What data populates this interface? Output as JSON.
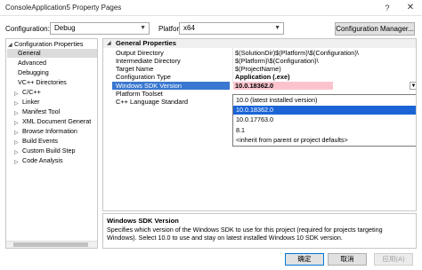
{
  "window": {
    "title": "ConsoleApplication5 Property Pages",
    "help_glyph": "?",
    "close_glyph": "✕"
  },
  "config": {
    "configuration_label": "Configuration:",
    "configuration_value": "Debug",
    "platform_label": "Platform:",
    "platform_value": "x64",
    "manager_button": "Configuration Manager..."
  },
  "tree": {
    "root": "Configuration Properties",
    "items": [
      {
        "label": "General",
        "selected": true,
        "expandable": false
      },
      {
        "label": "Advanced",
        "expandable": false
      },
      {
        "label": "Debugging",
        "expandable": false
      },
      {
        "label": "VC++ Directories",
        "expandable": false
      },
      {
        "label": "C/C++",
        "expandable": true
      },
      {
        "label": "Linker",
        "expandable": true
      },
      {
        "label": "Manifest Tool",
        "expandable": true
      },
      {
        "label": "XML Document Generat",
        "expandable": true
      },
      {
        "label": "Browse Information",
        "expandable": true
      },
      {
        "label": "Build Events",
        "expandable": true
      },
      {
        "label": "Custom Build Step",
        "expandable": true
      },
      {
        "label": "Code Analysis",
        "expandable": true
      }
    ]
  },
  "grid": {
    "section": "General Properties",
    "rows": [
      {
        "name": "Output Directory",
        "value": "$(SolutionDir)$(Platform)\\$(Configuration)\\"
      },
      {
        "name": "Intermediate Directory",
        "value": "$(Platform)\\$(Configuration)\\"
      },
      {
        "name": "Target Name",
        "value": "$(ProjectName)"
      },
      {
        "name": "Configuration Type",
        "value": "Application (.exe)"
      },
      {
        "name": "Windows SDK Version",
        "value": "10.0.18362.0"
      },
      {
        "name": "Platform Toolset",
        "value": ""
      },
      {
        "name": "C++ Language Standard",
        "value": ""
      }
    ],
    "dropdown_options": [
      "10.0 (latest installed version)",
      "10.0.18362.0",
      "10.0.17763.0",
      "8.1",
      "<inherit from parent or project defaults>"
    ],
    "dropdown_selected_index": 1
  },
  "description": {
    "title": "Windows SDK Version",
    "text": "Specifies which version of the Windows SDK to use for this project (required for projects targeting Windows). Select 10.0 to use and stay on latest installed Windows 10 SDK version."
  },
  "buttons": {
    "ok": "确定",
    "cancel": "取消",
    "apply": "应用(A)"
  }
}
